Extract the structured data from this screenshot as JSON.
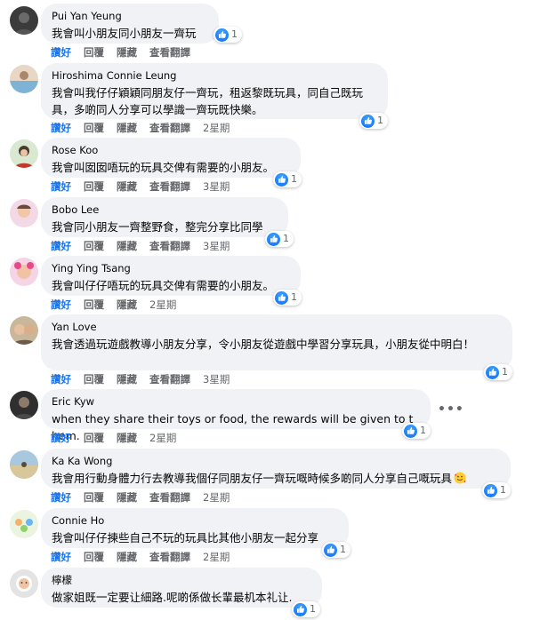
{
  "actions": {
    "like": "讚好",
    "reply": "回覆",
    "hide": "隱藏",
    "translate": "查看翻譯"
  },
  "colors": {
    "like_blue": "#1b74e4",
    "bubble_bg": "#f0f2f5",
    "meta_gray": "#65676b"
  },
  "comments": [
    {
      "author": "Pui Yan Yeung",
      "text": "我會叫小朋友同小朋友一齊玩",
      "reactions": "1",
      "time": "",
      "avatar_icon": "profile-photo"
    },
    {
      "author": "Hiroshima Connie Leung",
      "text": "我會叫我仔仔穎穎同朋友仔一齊玩，租返黎既玩具，同自己既玩具，多啲同人分享可以學識一齊玩既快樂。",
      "reactions": "1",
      "time": "2星期",
      "avatar_icon": "profile-photo"
    },
    {
      "author": "Rose Koo",
      "text": "我會叫囡囡唔玩的玩具交俾有需要的小朋友。",
      "reactions": "1",
      "time": "3星期",
      "avatar_icon": "profile-photo"
    },
    {
      "author": "Bobo Lee",
      "text": "我會同小朋友一齊整野食，整完分享比同學",
      "reactions": "1",
      "time": "3星期",
      "avatar_icon": "profile-photo"
    },
    {
      "author": "Ying Ying Tsang",
      "text": "我會叫仔仔唔玩的玩具交俾有需要的小朋友。",
      "reactions": "1",
      "time": "2星期",
      "avatar_icon": "profile-photo"
    },
    {
      "author": "Yan Love",
      "text": "我會透過玩遊戲教導小朋友分享，令小朋友從遊戲中學習分享玩具，小朋友從中明白！",
      "reactions": "1",
      "time": "3星期",
      "avatar_icon": "profile-photo"
    },
    {
      "author": "Eric Kyw",
      "text": "when they share their toys or food, the rewards will be given to them.",
      "reactions": "1",
      "time": "2星期",
      "avatar_icon": "profile-photo"
    },
    {
      "author": "Ka Ka Wong",
      "text": "我會用行動身體力行去教導我個仔同朋友仔一齊玩嘅時候多啲同人分享自己嘅玩具",
      "reactions": "1",
      "time": "2星期",
      "avatar_icon": "profile-photo",
      "emoji": "smiling-face-with-hearts"
    },
    {
      "author": "Connie Ho",
      "text": "我會叫仔仔揀些自己不玩的玩具比其他小朋友一起分享",
      "reactions": "1",
      "time": "2星期",
      "avatar_icon": "profile-photo"
    },
    {
      "author": "檸檬",
      "text": "做家姐既一定要让細路.呢啲係做长輩最机本礼让.",
      "reactions": "1",
      "time": "",
      "avatar_icon": "profile-photo"
    }
  ]
}
